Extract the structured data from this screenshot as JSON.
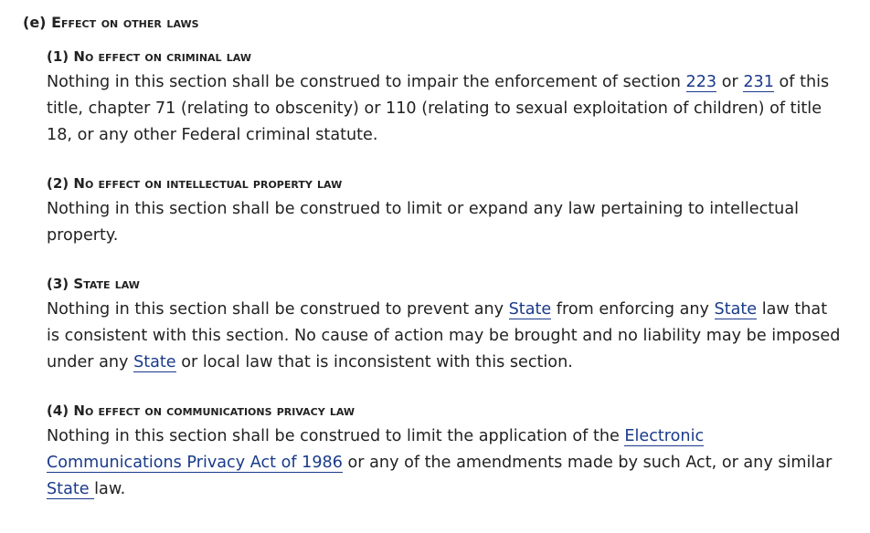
{
  "section": {
    "label": "(e)",
    "title_first": "E",
    "title_rest": "ffect on other laws"
  },
  "subsections": [
    {
      "label": "(1)",
      "title_first": "N",
      "title_rest": "o effect on criminal law",
      "text": {
        "p1": "Nothing in this section shall be construed to impair the enforcement of section ",
        "link1": "223",
        "p2": " or ",
        "link2": "231",
        "p3": " of this title, chapter 71 (relating to obscenity) or 110 (relating to sexual exploitation of children) of title 18, or any other Federal criminal statute."
      }
    },
    {
      "label": "(2)",
      "title_first": "N",
      "title_rest": "o effect on intellectual property law",
      "text": {
        "p1": "Nothing in this section shall be construed to limit or expand any law pertaining to intellectual property."
      }
    },
    {
      "label": "(3)",
      "title_first": "S",
      "title_rest": "tate law",
      "text": {
        "p1": "Nothing in this section shall be construed to prevent any ",
        "link1": "State",
        "p2": " from enforcing any ",
        "link2": "State",
        "p3": " law that is consistent with this section. No cause of action may be brought and no liability may be imposed under any ",
        "link3": "State",
        "p4": " or local law that is inconsistent with this section."
      }
    },
    {
      "label": "(4)",
      "title_first": "N",
      "title_rest": "o effect on communications privacy law",
      "text": {
        "p1": "Nothing in this section shall be construed to limit the application of the ",
        "link1": "Electronic Communications Privacy Act of 1986",
        "p2": " or any of the amendments made by such Act, or any similar ",
        "link2": "State ",
        "p3": "law."
      }
    }
  ],
  "colors": {
    "text": "#222222",
    "link": "#1a3a8a",
    "background": "#ffffff"
  }
}
